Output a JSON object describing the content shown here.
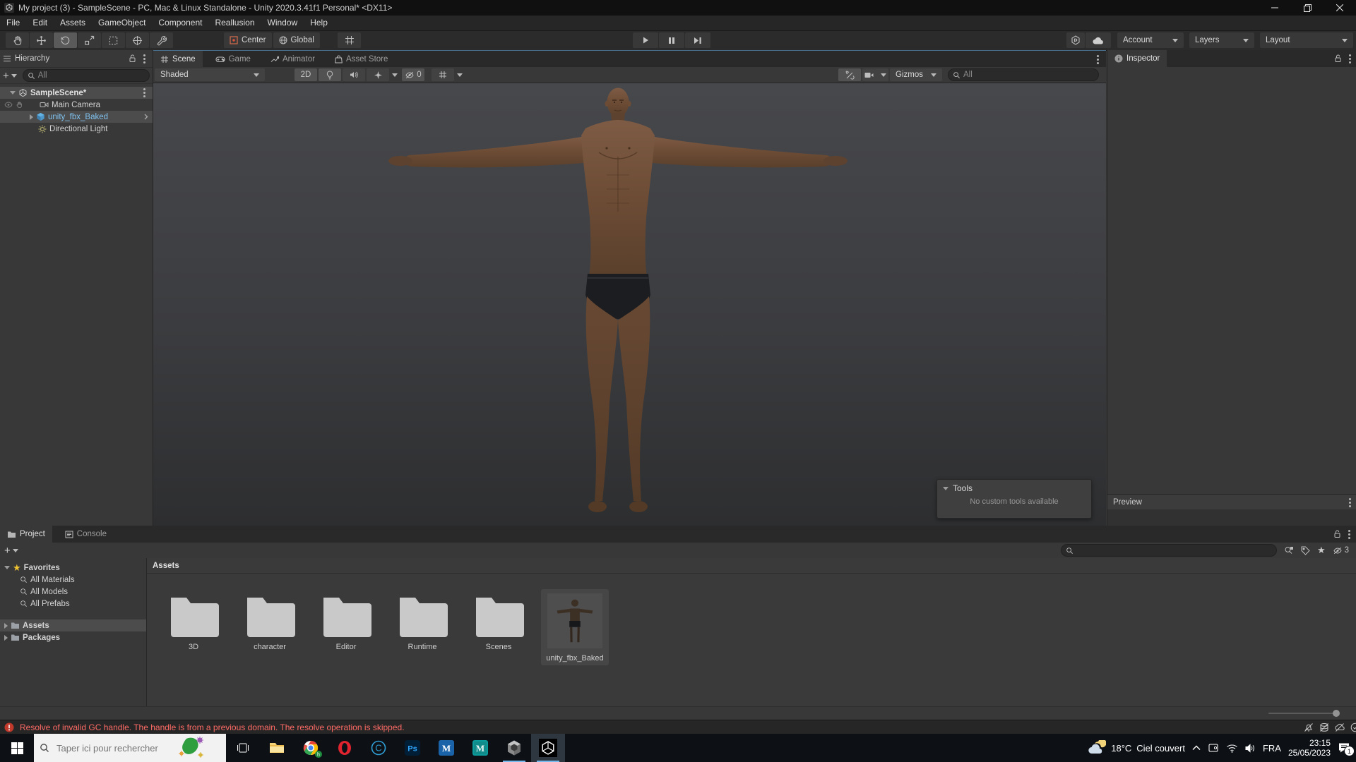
{
  "window": {
    "title": "My project (3) - SampleScene - PC, Mac & Linux Standalone - Unity 2020.3.41f1 Personal* <DX11>"
  },
  "menubar": {
    "items": [
      "File",
      "Edit",
      "Assets",
      "GameObject",
      "Component",
      "Reallusion",
      "Window",
      "Help"
    ]
  },
  "toolbar": {
    "pivot_label": "Center",
    "orientation_label": "Global",
    "account_label": "Account",
    "layers_label": "Layers",
    "layout_label": "Layout"
  },
  "hierarchy": {
    "title": "Hierarchy",
    "search_value": "All",
    "scene_row": "SampleScene*",
    "items": [
      {
        "label": "Main Camera"
      },
      {
        "label": "unity_fbx_Baked"
      },
      {
        "label": "Directional Light"
      }
    ]
  },
  "scene": {
    "tabs": [
      {
        "label": "Scene"
      },
      {
        "label": "Game"
      },
      {
        "label": "Animator"
      },
      {
        "label": "Asset Store"
      }
    ],
    "shading_mode": "Shaded",
    "mode_2d": "2D",
    "hidden_objects_count": "0",
    "gizmos_label": "Gizmos",
    "search_value": "All",
    "tools_overlay": {
      "title": "Tools",
      "message": "No custom tools available"
    }
  },
  "inspector": {
    "title": "Inspector",
    "preview_title": "Preview"
  },
  "project": {
    "tabs": [
      {
        "label": "Project"
      },
      {
        "label": "Console"
      }
    ],
    "favorites_label": "Favorites",
    "favorites": [
      {
        "label": "All Materials"
      },
      {
        "label": "All Models"
      },
      {
        "label": "All Prefabs"
      }
    ],
    "roots": [
      {
        "label": "Assets"
      },
      {
        "label": "Packages"
      }
    ],
    "breadcrumb": "Assets",
    "search_value": "",
    "hidden_count": "3",
    "folders": [
      {
        "label": "3D"
      },
      {
        "label": "character"
      },
      {
        "label": "Editor"
      },
      {
        "label": "Runtime"
      },
      {
        "label": "Scenes"
      }
    ],
    "selected_asset": {
      "label": "unity_fbx_Baked"
    }
  },
  "statusbar": {
    "error_message": "Resolve of invalid GC handle. The handle is from a previous domain. The resolve operation is skipped."
  },
  "taskbar": {
    "search_placeholder": "Taper ici pour rechercher",
    "weather": {
      "temp": "18°C",
      "condition": "Ciel couvert"
    },
    "language": "FRA",
    "clock": {
      "time": "23:15",
      "date": "25/05/2023"
    },
    "notifications_count": "1",
    "app_icons": [
      "task-view",
      "file-explorer",
      "chrome",
      "opera",
      "c-tool",
      "photoshop",
      "maya",
      "maya-alt",
      "unity-hub",
      "unity-editor"
    ]
  },
  "colors": {
    "prefab_blue": "#7fc1ee",
    "error_red": "#ff6b66",
    "selection_gray": "#4c4c4c",
    "taskbar_accent": "#76b9ed",
    "favorites_star": "#f0c330",
    "scene_focus_line": "#49708f"
  }
}
